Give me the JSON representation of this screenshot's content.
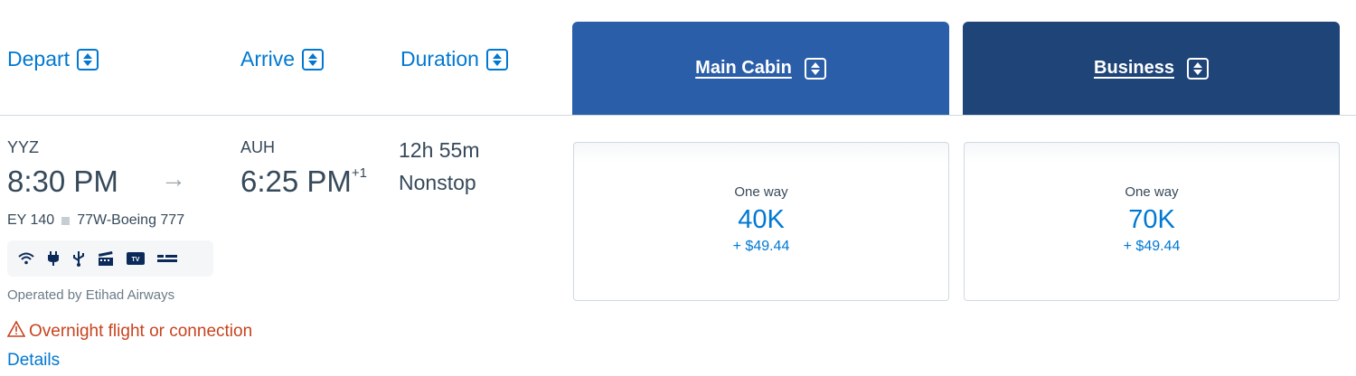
{
  "columns": {
    "depart": "Depart",
    "arrive": "Arrive",
    "duration": "Duration",
    "main_cabin": "Main Cabin",
    "business": "Business"
  },
  "colors": {
    "link": "#0078d2",
    "main_cabin_bg": "#2a5ea8",
    "business_bg": "#1e4478",
    "warning": "#c8431f"
  },
  "flight": {
    "origin": "YYZ",
    "depart_time": "8:30 PM",
    "destination": "AUH",
    "arrive_time": "6:25 PM",
    "day_offset": "+1",
    "duration": "12h 55m",
    "stops": "Nonstop",
    "flight_number": "EY 140",
    "aircraft": "77W-Boeing 777",
    "operated_by": "Operated by Etihad Airways",
    "warning": "Overnight flight or connection",
    "details_link": "Details",
    "amenities": [
      "wifi-icon",
      "power-outlet-icon",
      "usb-icon",
      "entertainment-icon",
      "tv-icon",
      "lie-flat-seat-icon"
    ]
  },
  "fares": {
    "main": {
      "label": "One way",
      "miles": "40K",
      "tax": "+ $49.44"
    },
    "business": {
      "label": "One way",
      "miles": "70K",
      "tax": "+ $49.44"
    }
  }
}
